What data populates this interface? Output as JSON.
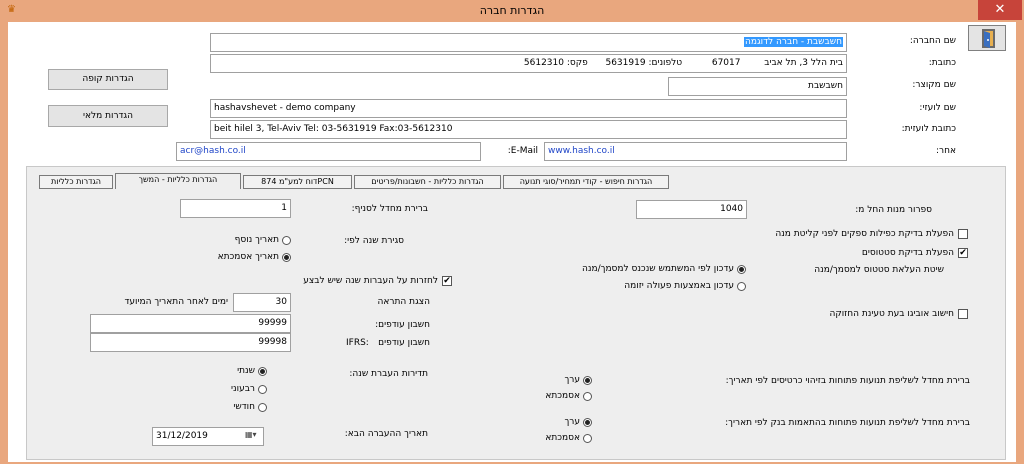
{
  "window": {
    "title": "הגדרות חברה",
    "close_glyph": "✕",
    "app_icon_glyph": "♛"
  },
  "header": {
    "company_name_label": "שם החברה:",
    "company_name_value": "חשבשבת - חברה לדוגמה",
    "address_label": "כתובת:",
    "address_street": "בית הלל 3, תל אביב",
    "address_zip": "67017",
    "address_phone": "טלפונים: 5631919",
    "address_fax": "פקס: 5612310",
    "short_name_label": "שם מקוצר:",
    "short_name_value": "חשבשבת",
    "foreign_name_label": "שם לועזי:",
    "foreign_name_value": "hashavshevet - demo company",
    "foreign_address_label": "כתובת לועזית:",
    "foreign_address_value": "beit hilel 3,  Tel-Aviv   Tel: 03-5631919    Fax:03-5612310",
    "other_label": "אחר:",
    "website_value": "www.hash.co.il",
    "email_label": "E-Mail:",
    "email_value": "acr@hash.co.il",
    "register_settings_button": "הגדרות קופה",
    "inventory_settings_button": "הגדרות מלאי"
  },
  "tabs": [
    "הגדרות חיפוש - קודי תמחיר/סוגי תנועה",
    "הגדרות כלליות - חשבונות/פריטים",
    "דוח למע\"מ  874PCN",
    "הגדרות כלליות - המשך",
    "הגדרות כלליות"
  ],
  "panel": {
    "closing_check_label": "ספרור מנות החל מ:",
    "closing_check_value": "1040",
    "default_count_label": "ברירת מחדל לסניף:",
    "default_count_value": "1",
    "supplier_check_label": "הפעלת בדיקת כפילות ספקים לפני קליטת מנה",
    "status_check_label": "הפעלת בדיקת סטטוסים",
    "status_method_label": "שיטת העלאת סטטוס למסמך/מנה",
    "status_opt1": "עדכון לפי המשתמש שנכנס למסמך/מנה",
    "status_opt2": "עדכון באמצעות פעולה יזומה",
    "rounding_check_label": "חישוב אוביגו בעת טעינת החזוקה",
    "year_close_label": "סגירת שנה לפי:",
    "year_opt1": "תאריך נוסף",
    "year_opt2": "תאריך אסמכתא",
    "transfer_check_label": "לחזרות על העברות שנה שיש לבצע",
    "alert_label": "הצגת התראה",
    "alert_value": "30",
    "alert_suffix": "ימים לאחר התאריך המיועד",
    "surplus_label": "חשבון עודפים:",
    "surplus_value": "99999",
    "surplus_ifrs_label": "חשבון עודפים",
    "ifrs_label": "IFRS:",
    "surplus_ifrs_value": "99998",
    "period_label": "תדירות העברת שנה:",
    "period_opt1": "שנתי",
    "period_opt2": "רבעוני",
    "period_opt3": "חודשי",
    "next_transfer_label": "תאריך ההעברה הבא:",
    "next_transfer_value": "31/12/2019",
    "default_open_label": "ברירת מחדל לשליפת תנועות פתוחות בזיהוי כרטיסים לפי תאריך:",
    "default_open_opt1": "ערך",
    "default_open_opt2": "אסמכתא",
    "default_bank_label": "ברירת מחדל לשליפת תנועות פתוחות בהתאמות בנק לפי תאריך:",
    "default_bank_opt1": "ערך",
    "default_bank_opt2": "אסמכתא"
  },
  "colors": {
    "title_bar": "#e9a77e",
    "close_button": "#c7443a",
    "selection": "#3399ff",
    "link": "#2046c8"
  }
}
